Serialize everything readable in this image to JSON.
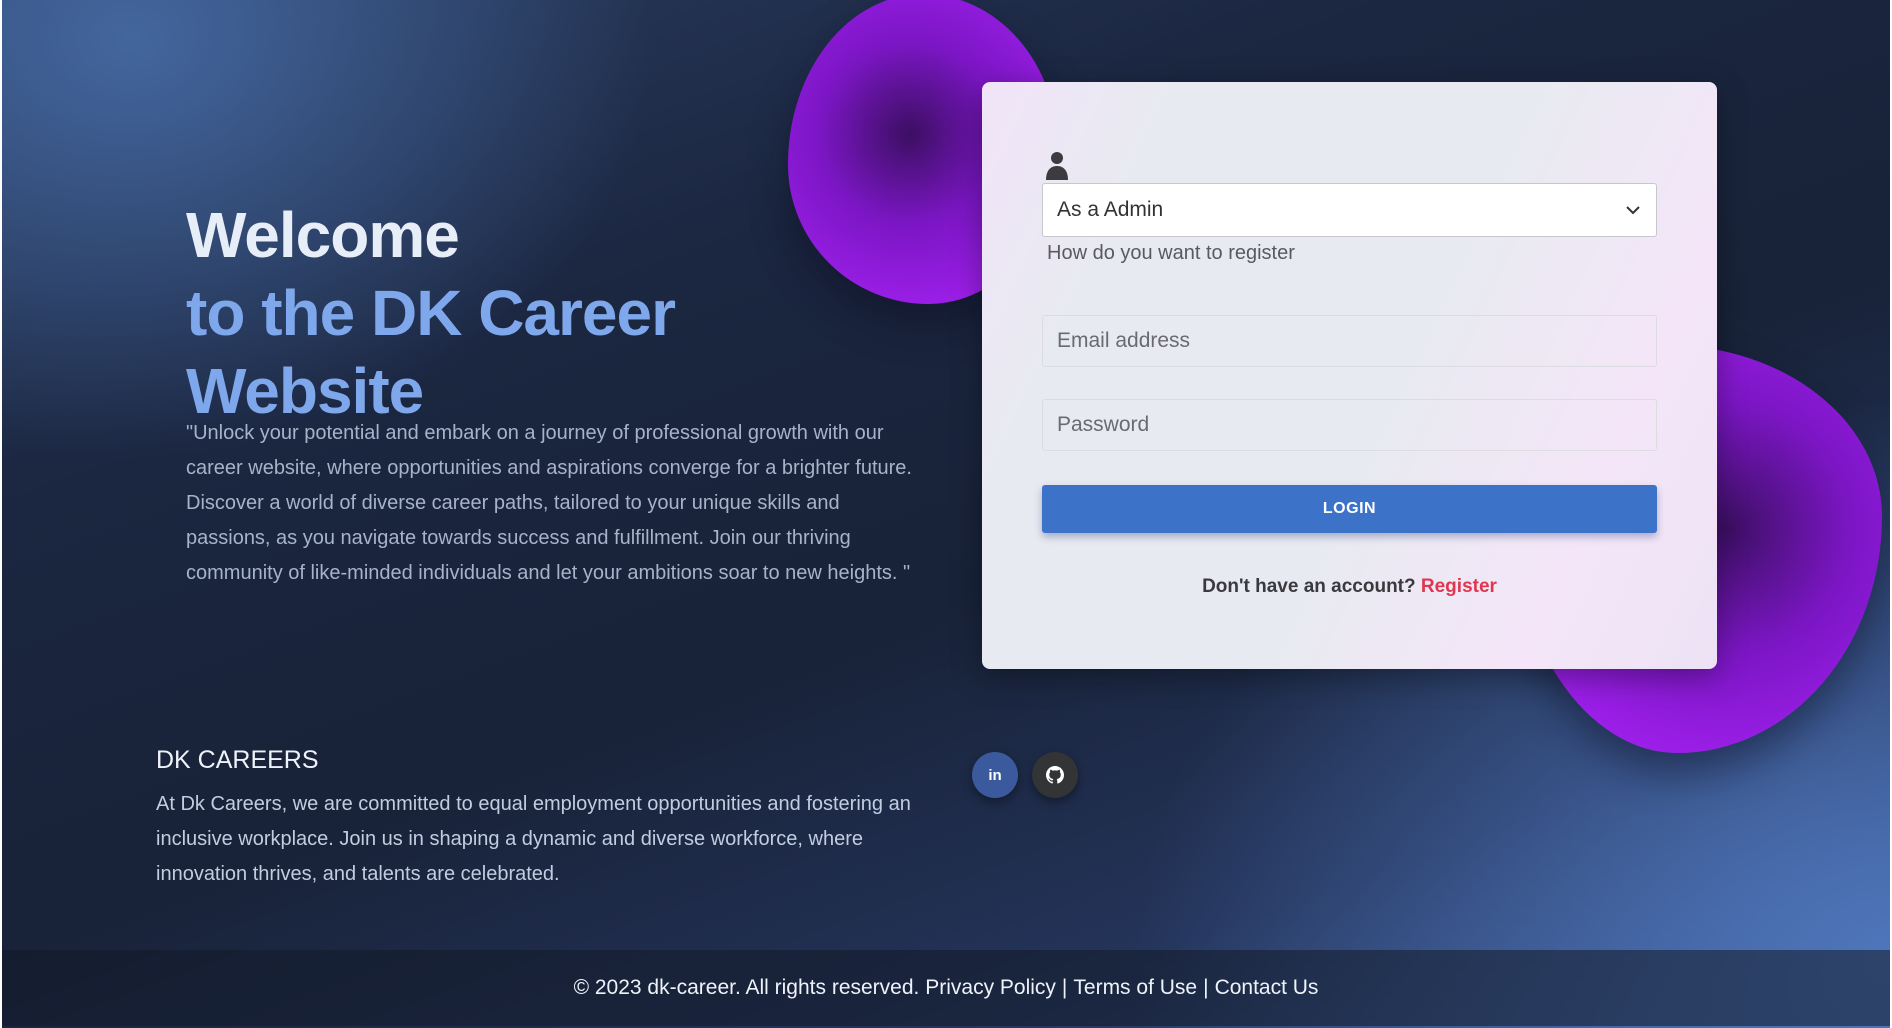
{
  "hero": {
    "title": "Welcome",
    "subtitle": "to the DK Career Website",
    "quote": "\"Unlock your potential and embark on a journey of professional growth with our career website, where opportunities and aspirations converge for a brighter future. Discover a world of diverse career paths, tailored to your unique skills and passions, as you navigate towards success and fulfillment. Join our thriving community of like-minded individuals and let your ambitions soar to new heights. \""
  },
  "login_form": {
    "role_select": {
      "value": "As a Admin",
      "helper": "How do you want to register"
    },
    "email": {
      "placeholder": "Email address"
    },
    "password": {
      "placeholder": "Password"
    },
    "login_label": "LOGIN",
    "register_prompt": "Don't have an account?",
    "register_link": "Register"
  },
  "about": {
    "title": "DK CAREERS",
    "text": "At Dk Careers, we are committed to equal employment opportunities and fostering an inclusive workplace. Join us in shaping a dynamic and diverse workforce, where innovation thrives, and talents are celebrated."
  },
  "social": {
    "linkedin_label": "in",
    "icons": [
      "linkedin-icon",
      "github-icon"
    ]
  },
  "footer": {
    "copyright": "© 2023 dk-career. All rights reserved.",
    "privacy": "Privacy Policy",
    "separator": "|",
    "terms": "Terms of Use",
    "contact": "Contact Us"
  },
  "colors": {
    "accent_blue": "#3d72c9",
    "register_red": "#e0364f",
    "blob_purple": "#9a1ee6",
    "subtitle_blue": "#7fa7ec"
  }
}
